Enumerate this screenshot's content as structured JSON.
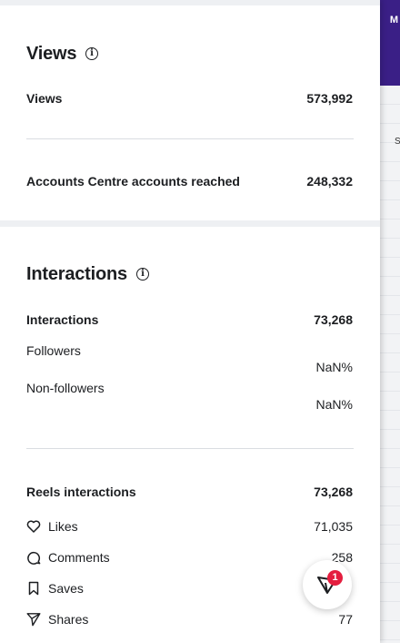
{
  "views_section": {
    "title": "Views",
    "rows": [
      {
        "label": "Views",
        "value": "573,992"
      },
      {
        "label": "Accounts Centre accounts reached",
        "value": "248,332"
      }
    ]
  },
  "interactions_section": {
    "title": "Interactions",
    "total": {
      "label": "Interactions",
      "value": "73,268"
    },
    "followers": {
      "label": "Followers",
      "value": "NaN%"
    },
    "non_followers": {
      "label": "Non-followers",
      "value": "NaN%"
    },
    "reels": {
      "label": "Reels interactions",
      "value": "73,268"
    },
    "breakdown": [
      {
        "icon": "heart-icon",
        "label": "Likes",
        "value": "71,035"
      },
      {
        "icon": "comment-icon",
        "label": "Comments",
        "value": "258"
      },
      {
        "icon": "bookmark-icon",
        "label": "Saves",
        "value": ""
      },
      {
        "icon": "send-icon",
        "label": "Shares",
        "value": "77"
      }
    ]
  },
  "fab": {
    "badge": "1",
    "icon": "lasso-icon"
  },
  "background": {
    "header_letter": "M",
    "col_letter": "S"
  }
}
